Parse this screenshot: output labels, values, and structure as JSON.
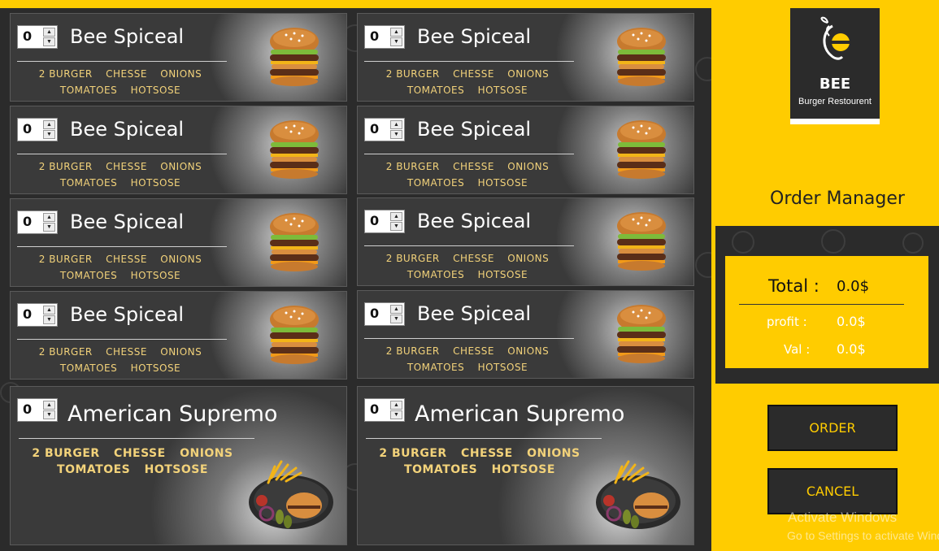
{
  "brand": {
    "name": "BEE",
    "subtitle": "Burger Restourent",
    "colors": {
      "accent": "#FFCC00",
      "dark": "#2B2B2B",
      "ingredient_text": "#F2D27A"
    }
  },
  "menu": {
    "items": [
      {
        "quantity": "0",
        "title": "Bee Spiceal",
        "ingredients_line1": [
          "2 BURGER",
          "CHESSE",
          "ONIONS"
        ],
        "ingredients_line2": [
          "TOMATOES",
          "HOTSOSE"
        ],
        "icon": "burger-icon"
      },
      {
        "quantity": "0",
        "title": "Bee Spiceal",
        "ingredients_line1": [
          "2 BURGER",
          "CHESSE",
          "ONIONS"
        ],
        "ingredients_line2": [
          "TOMATOES",
          "HOTSOSE"
        ],
        "icon": "burger-icon"
      },
      {
        "quantity": "0",
        "title": "Bee Spiceal",
        "ingredients_line1": [
          "2 BURGER",
          "CHESSE",
          "ONIONS"
        ],
        "ingredients_line2": [
          "TOMATOES",
          "HOTSOSE"
        ],
        "icon": "burger-icon"
      },
      {
        "quantity": "0",
        "title": "Bee Spiceal",
        "ingredients_line1": [
          "2 BURGER",
          "CHESSE",
          "ONIONS"
        ],
        "ingredients_line2": [
          "TOMATOES",
          "HOTSOSE"
        ],
        "icon": "burger-icon"
      },
      {
        "quantity": "0",
        "title": "Bee Spiceal",
        "ingredients_line1": [
          "2 BURGER",
          "CHESSE",
          "ONIONS"
        ],
        "ingredients_line2": [
          "TOMATOES",
          "HOTSOSE"
        ],
        "icon": "burger-icon"
      },
      {
        "quantity": "0",
        "title": "Bee Spiceal",
        "ingredients_line1": [
          "2 BURGER",
          "CHESSE",
          "ONIONS"
        ],
        "ingredients_line2": [
          "TOMATOES",
          "HOTSOSE"
        ],
        "icon": "burger-icon"
      },
      {
        "quantity": "0",
        "title": "Bee Spiceal",
        "ingredients_line1": [
          "2 BURGER",
          "CHESSE",
          "ONIONS"
        ],
        "ingredients_line2": [
          "TOMATOES",
          "HOTSOSE"
        ],
        "icon": "burger-icon"
      },
      {
        "quantity": "0",
        "title": "Bee Spiceal",
        "ingredients_line1": [
          "2 BURGER",
          "CHESSE",
          "ONIONS"
        ],
        "ingredients_line2": [
          "TOMATOES",
          "HOTSOSE"
        ],
        "icon": "burger-icon"
      },
      {
        "quantity": "0",
        "title": "American Supremo",
        "ingredients_line1": [
          "2 BURGER",
          "CHESSE",
          "ONIONS"
        ],
        "ingredients_line2": [
          "TOMATOES",
          "HOTSOSE"
        ],
        "icon": "meal-plate-icon"
      },
      {
        "quantity": "0",
        "title": "American Supremo",
        "ingredients_line1": [
          "2 BURGER",
          "CHESSE",
          "ONIONS"
        ],
        "ingredients_line2": [
          "TOMATOES",
          "HOTSOSE"
        ],
        "icon": "meal-plate-icon"
      }
    ]
  },
  "order_manager": {
    "title": "Order Manager",
    "total_label": "Total :",
    "total_value": "0.0$",
    "profit_label": "profit :",
    "profit_value": "0.0$",
    "val_label": "Val :",
    "val_value": "0.0$",
    "order_button": "ORDER",
    "cancel_button": "CANCEL"
  },
  "watermark": {
    "line1": "Activate Windows",
    "line2": "Go to Settings to activate Windows."
  }
}
